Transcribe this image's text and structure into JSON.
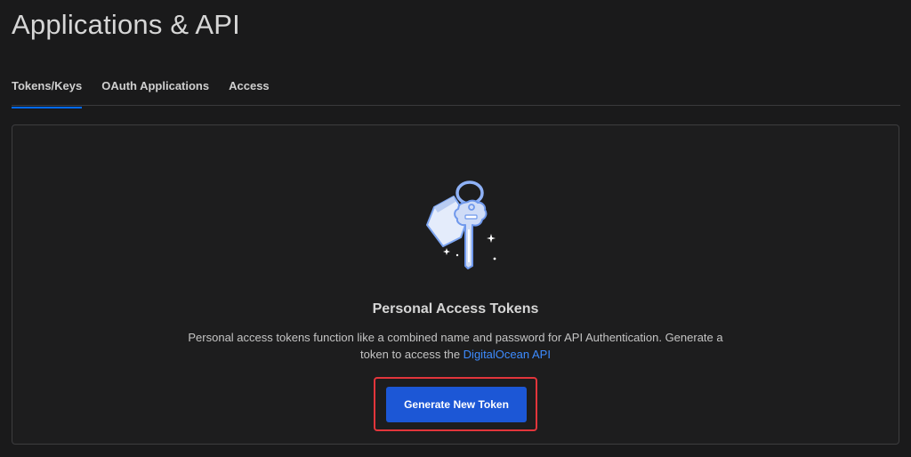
{
  "header": {
    "title": "Applications & API"
  },
  "tabs": [
    {
      "label": "Tokens/Keys",
      "active": true
    },
    {
      "label": "OAuth Applications",
      "active": false
    },
    {
      "label": "Access",
      "active": false
    }
  ],
  "tokens_card": {
    "illustration_icon": "key-tag-icon",
    "heading": "Personal Access Tokens",
    "description_line1": "Personal access tokens function like a combined name and password for API Authentication. Generate a",
    "description_line2_prefix": "token to access the ",
    "api_link_label": "DigitalOcean API",
    "generate_button_label": "Generate New Token"
  },
  "colors": {
    "background": "#1a1a1b",
    "accent_blue": "#0069ff",
    "button_blue": "#1c57d6",
    "link_blue": "#3d8bff",
    "highlight_red": "#e2353b"
  }
}
